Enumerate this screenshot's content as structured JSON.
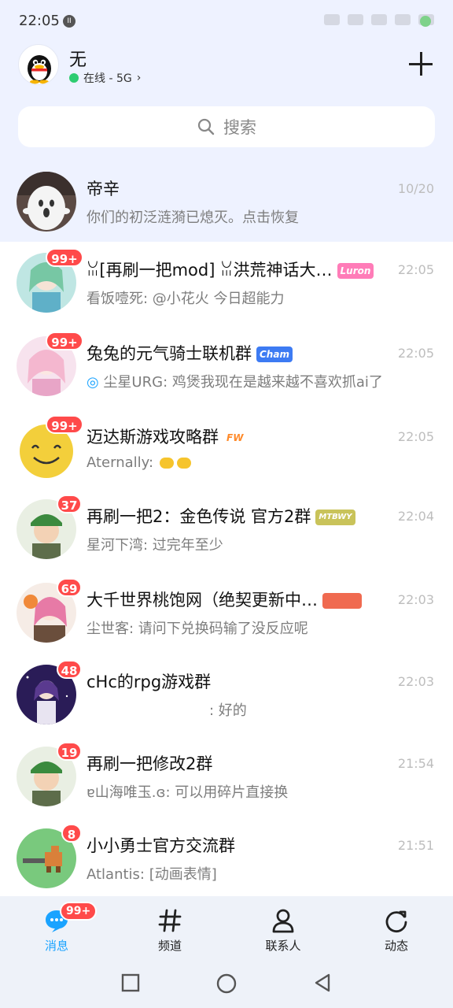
{
  "status_bar": {
    "time": "22:05"
  },
  "header": {
    "name": "无",
    "status": "在线 - 5G"
  },
  "search": {
    "placeholder": "搜索"
  },
  "conversations": [
    {
      "title": "帝辛",
      "subtitle": "你们的初泛涟漪已熄灭。点击恢复",
      "time": "10/20",
      "badge": ""
    },
    {
      "title": "ꈍ[再刷一把mod] ꈍ洪荒神话大…",
      "tag": "Luron",
      "subtitle": "看饭噎死: @小花火 今日超能力",
      "time": "22:05",
      "badge": "99+"
    },
    {
      "title": "兔兔的元气骑士联机群",
      "tag": "Cham",
      "subtitle": "尘星URG: 鸡煲我现在是越来越不喜欢抓ai了",
      "time": "22:05",
      "badge": "99+"
    },
    {
      "title": "迈达斯游戏攻略群",
      "tag": "FW",
      "subtitle": "Aternally: ",
      "time": "22:05",
      "badge": "99+"
    },
    {
      "title": "再刷一把2：金色传说 官方2群",
      "tag": "MTBWY",
      "subtitle": "星河下湾: 过完年至少",
      "time": "22:04",
      "badge": "37"
    },
    {
      "title": "大千世界桃饱网（绝契更新中…",
      "tag": "",
      "subtitle": "尘世客: 请问下兑换码输了没反应呢",
      "time": "22:03",
      "badge": "69"
    },
    {
      "title": "cHc的rpg游戏群",
      "subtitle": ": 好的",
      "time": "22:03",
      "badge": "48"
    },
    {
      "title": "再刷一把修改2群",
      "subtitle": "ɐ山海唯玉.ɞ: 可以用碎片直接换",
      "time": "21:54",
      "badge": "19"
    },
    {
      "title": "小小勇士官方交流群",
      "subtitle": "Atlantis: [动画表情]",
      "time": "21:51",
      "badge": "8"
    }
  ],
  "bottom_nav": {
    "tabs": [
      {
        "label": "消息",
        "badge": "99+"
      },
      {
        "label": "频道"
      },
      {
        "label": "联系人"
      },
      {
        "label": "动态"
      }
    ]
  },
  "colors": {
    "accent": "#1aa3ff",
    "badge": "#ff4a4a",
    "top_bg": "#eef2ff"
  }
}
